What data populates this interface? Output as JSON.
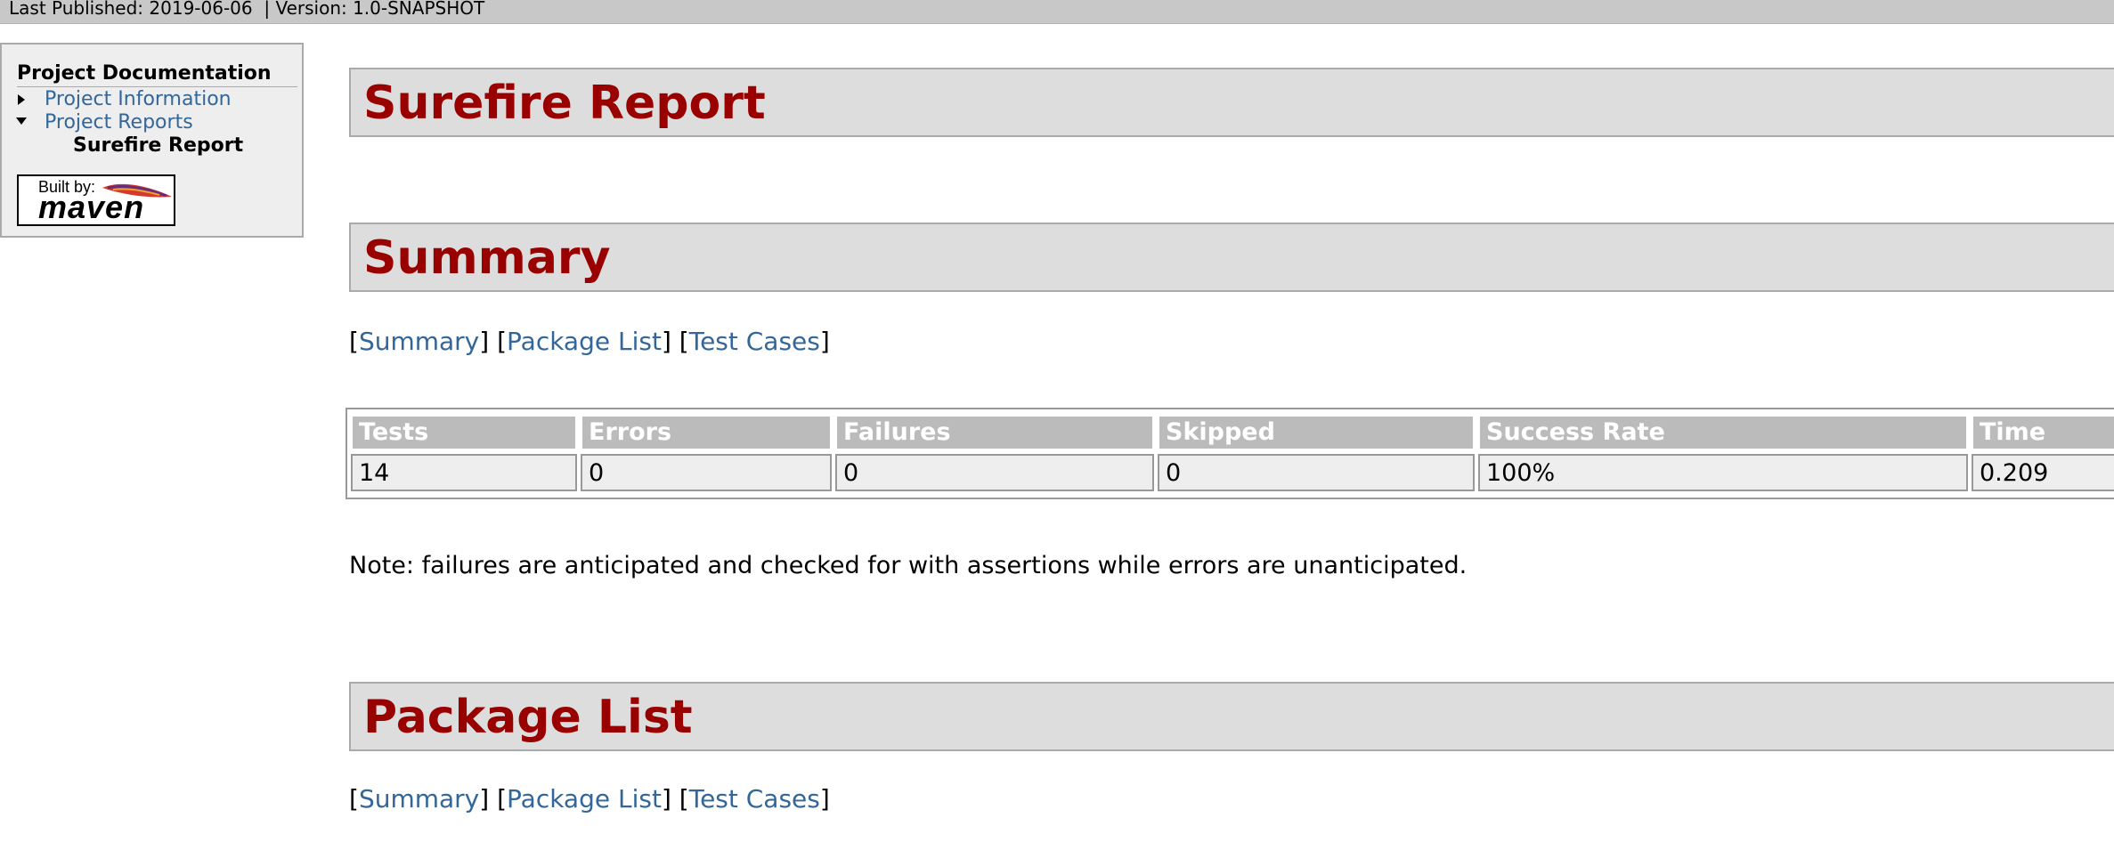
{
  "banner": {
    "meta": "Last Published: 2019-06-06  | Version: 1.0-SNAPSHOT"
  },
  "nav": {
    "heading": "Project Documentation",
    "items": [
      {
        "label": "Project Information"
      },
      {
        "label": "Project Reports"
      },
      {
        "label": "Surefire Report"
      }
    ],
    "badge": {
      "built_by": "Built by:",
      "word": "maven"
    }
  },
  "main": {
    "title": "Surefire Report",
    "summary_heading": "Summary",
    "package_heading": "Package List",
    "crumbs": {
      "summary": "Summary",
      "package_list": "Package List",
      "test_cases": "Test Cases",
      "open": "[",
      "close": "]"
    },
    "table": {
      "headers": [
        "Tests",
        "Errors",
        "Failures",
        "Skipped",
        "Success Rate",
        "Time"
      ],
      "row": [
        "14",
        "0",
        "0",
        "0",
        "100%",
        "0.209"
      ]
    },
    "note": "Note: failures are anticipated and checked for with assertions while errors are unanticipated."
  },
  "colors": {
    "heading": "#990000",
    "link": "#336699",
    "banner": "#c8c8c8"
  }
}
